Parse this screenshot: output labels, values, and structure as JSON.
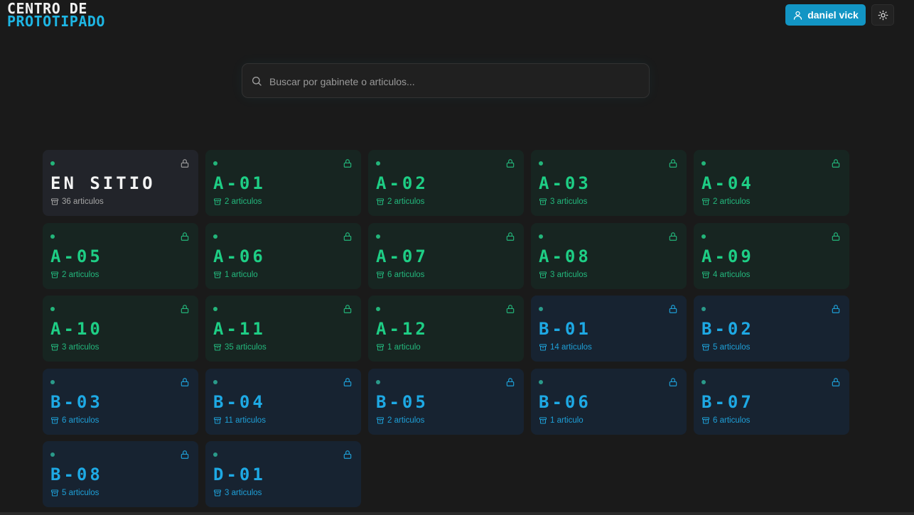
{
  "header": {
    "logo_line1": "CENTRO DE",
    "logo_line2": "PROTOTIPADO",
    "user_name": "daniel vick",
    "theme_icon": "sun-icon"
  },
  "search": {
    "placeholder": "Buscar por gabinete o articulos...",
    "value": ""
  },
  "colors": {
    "background": "#1a1a1a",
    "accent_blue": "#1295c4",
    "green": "#1ece85",
    "blue": "#1ea9e4",
    "white": "#f3f3f3"
  },
  "cabinets": [
    {
      "name": "EN SITIO",
      "count": "36 articulos",
      "theme": "white"
    },
    {
      "name": "A-01",
      "count": "2 articulos",
      "theme": "green"
    },
    {
      "name": "A-02",
      "count": "2 articulos",
      "theme": "green"
    },
    {
      "name": "A-03",
      "count": "3 articulos",
      "theme": "green"
    },
    {
      "name": "A-04",
      "count": "2 articulos",
      "theme": "green"
    },
    {
      "name": "A-05",
      "count": "2 articulos",
      "theme": "green"
    },
    {
      "name": "A-06",
      "count": "1 articulo",
      "theme": "green"
    },
    {
      "name": "A-07",
      "count": "6 articulos",
      "theme": "green"
    },
    {
      "name": "A-08",
      "count": "3 articulos",
      "theme": "green"
    },
    {
      "name": "A-09",
      "count": "4 articulos",
      "theme": "green"
    },
    {
      "name": "A-10",
      "count": "3 articulos",
      "theme": "green"
    },
    {
      "name": "A-11",
      "count": "35 articulos",
      "theme": "green"
    },
    {
      "name": "A-12",
      "count": "1 articulo",
      "theme": "green"
    },
    {
      "name": "B-01",
      "count": "14 articulos",
      "theme": "blue"
    },
    {
      "name": "B-02",
      "count": "5 articulos",
      "theme": "blue"
    },
    {
      "name": "B-03",
      "count": "6 articulos",
      "theme": "blue"
    },
    {
      "name": "B-04",
      "count": "11 articulos",
      "theme": "blue"
    },
    {
      "name": "B-05",
      "count": "2 articulos",
      "theme": "blue"
    },
    {
      "name": "B-06",
      "count": "1 articulo",
      "theme": "blue"
    },
    {
      "name": "B-07",
      "count": "6 articulos",
      "theme": "blue"
    },
    {
      "name": "B-08",
      "count": "5 articulos",
      "theme": "blue"
    },
    {
      "name": "D-01",
      "count": "3 articulos",
      "theme": "blue"
    }
  ]
}
